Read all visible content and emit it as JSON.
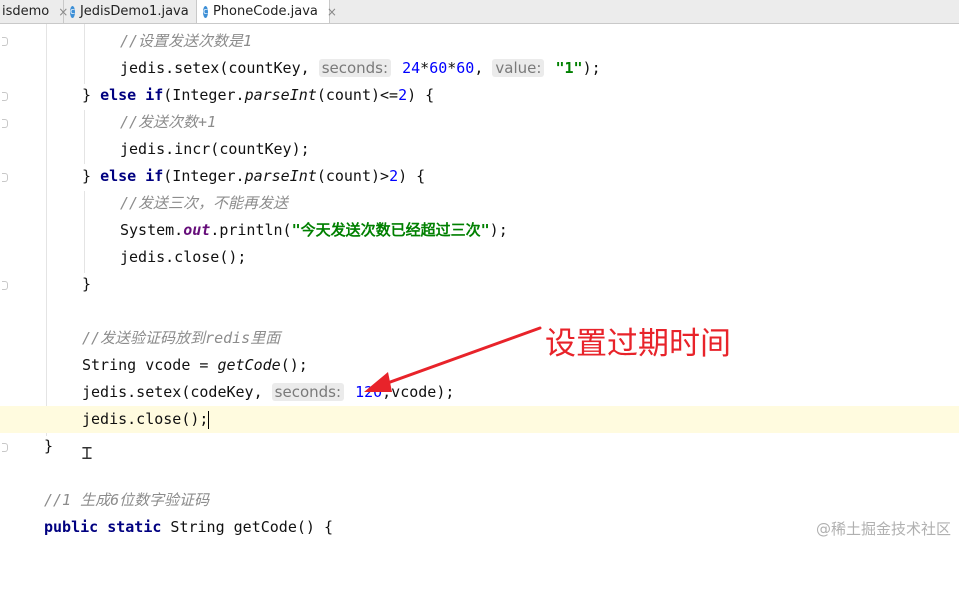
{
  "tabs": [
    {
      "label": "isdemo",
      "active": false,
      "icon": "none"
    },
    {
      "label": "JedisDemo1.java",
      "active": false,
      "icon": "class-icon"
    },
    {
      "label": "PhoneCode.java",
      "active": true,
      "icon": "class-icon"
    }
  ],
  "tab_close_glyph": "×",
  "code": {
    "l1": "//设置发送次数是1",
    "l2": {
      "a": "jedis.setex(countKey, ",
      "hint1": "seconds:",
      "b": " ",
      "n1": "24",
      "c": "*",
      "n2": "60",
      "d": "*",
      "n3": "60",
      "e": ", ",
      "hint2": "value:",
      "f": " ",
      "s": "\"1\"",
      "g": ");"
    },
    "l3": {
      "a": "} ",
      "kw1": "else",
      "b": " ",
      "kw2": "if",
      "c": "(Integer.",
      "m": "parseInt",
      "d": "(count)<=",
      "n": "2",
      "e": ") {"
    },
    "l4": "//发送次数+1",
    "l5": "jedis.incr(countKey);",
    "l6": {
      "a": "} ",
      "kw1": "else",
      "b": " ",
      "kw2": "if",
      "c": "(Integer.",
      "m": "parseInt",
      "d": "(count)>",
      "n": "2",
      "e": ") {"
    },
    "l7": "//发送三次，不能再发送",
    "l8": {
      "a": "System.",
      "f": "out",
      "b": ".println(",
      "s": "\"今天发送次数已经超过三次\"",
      "c": ");"
    },
    "l9": "jedis.close();",
    "l10": "}",
    "l11": "//发送验证码放到redis里面",
    "l12": {
      "a": "String vcode = ",
      "m": "getCode",
      "b": "();"
    },
    "l13": {
      "a": "jedis.setex(codeKey, ",
      "hint": "seconds:",
      "b": " ",
      "n": "120",
      "c": ",vcode);"
    },
    "l14": "jedis.close();",
    "l15": "}",
    "l16": "//1 生成6位数字验证码",
    "l17": {
      "kw1": "public",
      "a": " ",
      "kw2": "static",
      "b": " String getCode() {"
    }
  },
  "annotation": "设置过期时间",
  "watermark": "@稀土掘金技术社区",
  "colors": {
    "annotation": "#e8232a",
    "keyword": "#000080",
    "comment": "#8c8c8c",
    "string": "#008000",
    "number": "#0000ff"
  }
}
